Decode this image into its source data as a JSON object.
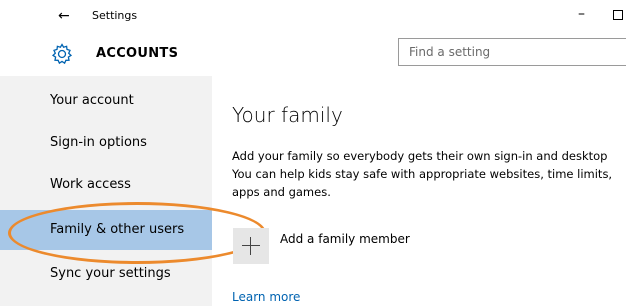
{
  "window": {
    "title": "Settings",
    "back_glyph": "←",
    "minimize_glyph": "–"
  },
  "header": {
    "section_title": "ACCOUNTS",
    "section_icon": "gear-icon"
  },
  "search": {
    "placeholder": "Find a setting"
  },
  "sidebar": {
    "items": [
      {
        "label": "Your account"
      },
      {
        "label": "Sign-in options"
      },
      {
        "label": "Work access"
      },
      {
        "label": "Family & other users"
      },
      {
        "label": "Sync your settings"
      }
    ],
    "selected_index": 3
  },
  "main": {
    "title": "Your family",
    "description_lines": [
      "Add your family so everybody gets their own sign-in and desktop",
      "You can help kids stay safe with appropriate websites, time limits,",
      "apps and games."
    ],
    "add_member_label": "Add a family member",
    "learn_more_label": "Learn more"
  },
  "colors": {
    "accent": "#0063b1",
    "selected_bg": "#a7c7e7",
    "sidebar_bg": "#f2f2f2",
    "annotation": "#ec8a2d"
  }
}
